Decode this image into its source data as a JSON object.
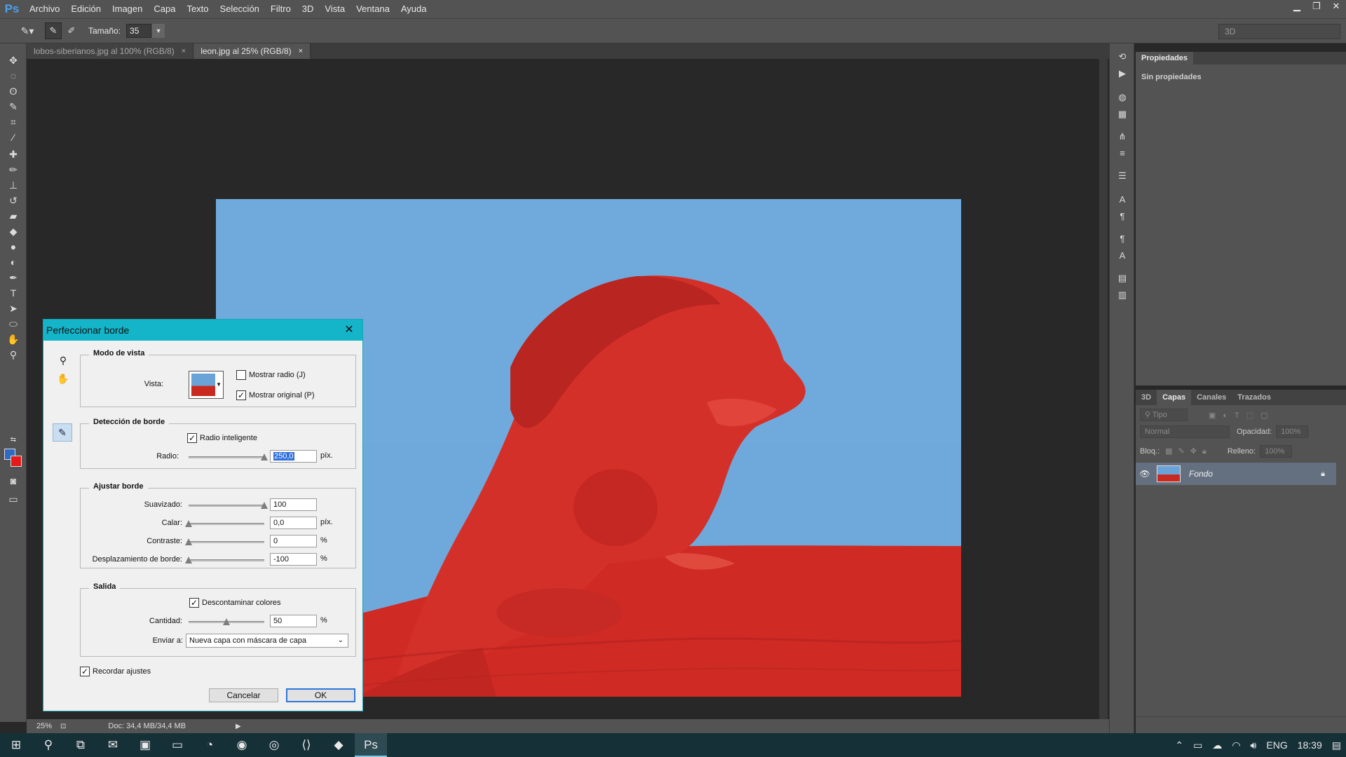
{
  "app": {
    "logo": "Ps",
    "menu": [
      "Archivo",
      "Edición",
      "Imagen",
      "Capa",
      "Texto",
      "Selección",
      "Filtro",
      "3D",
      "Vista",
      "Ventana",
      "Ayuda"
    ]
  },
  "options": {
    "size_label": "Tamaño:",
    "size_value": "35",
    "workspace": "3D"
  },
  "doc_tabs": [
    {
      "label": "lobos-siberianos.jpg al 100% (RGB/8)",
      "close": "×"
    },
    {
      "label": "leon.jpg al 25% (RGB/8)",
      "close": "×"
    }
  ],
  "status": {
    "zoom": "25%",
    "doc": "Doc: 34,4 MB/34,4 MB"
  },
  "properties": {
    "tab": "Propiedades",
    "empty": "Sin propiedades"
  },
  "layers_panel": {
    "tabs": [
      "3D",
      "Capas",
      "Canales",
      "Trazados"
    ],
    "filter": "Tipo",
    "blend_mode": "Normal",
    "opacity_label": "Opacidad:",
    "opacity_value": "100%",
    "lock_label": "Bloq.:",
    "fill_label": "Relleno:",
    "fill_value": "100%",
    "layer_name": "Fondo"
  },
  "dialog": {
    "title": "Perfeccionar borde",
    "close": "✕",
    "view_mode": {
      "title": "Modo de vista",
      "vista_label": "Vista:",
      "show_radius": "Mostrar radio (J)",
      "show_radius_checked": false,
      "show_original": "Mostrar original (P)",
      "show_original_checked": true
    },
    "edge_detection": {
      "title": "Detección de borde",
      "smart_radius": "Radio inteligente",
      "smart_radius_checked": true,
      "radius_label": "Radio:",
      "radius_value": "250,0",
      "radius_unit": "píx.",
      "radius_level": 1.0
    },
    "adjust_edge": {
      "title": "Ajustar borde",
      "smooth_label": "Suavizado:",
      "smooth_value": "100",
      "smooth_level": 1.0,
      "feather_label": "Calar:",
      "feather_value": "0,0",
      "feather_unit": "píx.",
      "feather_level": 0.0,
      "contrast_label": "Contraste:",
      "contrast_value": "0",
      "contrast_unit": "%",
      "contrast_level": 0.0,
      "shift_label": "Desplazamiento de borde:",
      "shift_value": "-100",
      "shift_unit": "%",
      "shift_level": 0.0
    },
    "output": {
      "title": "Salida",
      "decontaminate": "Descontaminar colores",
      "decontaminate_checked": true,
      "amount_label": "Cantidad:",
      "amount_value": "50",
      "amount_unit": "%",
      "amount_level": 0.5,
      "send_label": "Enviar a:",
      "send_value": "Nueva capa con máscara de capa"
    },
    "remember": "Recordar ajustes",
    "remember_checked": true,
    "cancel": "Cancelar",
    "ok": "OK"
  },
  "taskbar": {
    "lang": "ENG",
    "time": "18:39"
  },
  "colors": {
    "sky": "#6fa8db",
    "overlay_red": "#d22a22",
    "dialog_title": "#14b5c9",
    "foreground_swatch": "#2e69c4",
    "background_swatch": "#e51b1b"
  }
}
